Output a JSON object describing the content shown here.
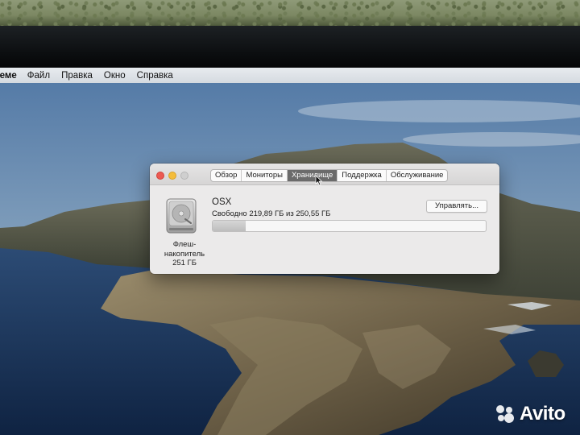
{
  "menubar": {
    "items": [
      "теме",
      "Файл",
      "Правка",
      "Окно",
      "Справка"
    ]
  },
  "window": {
    "tabs": [
      "Обзор",
      "Мониторы",
      "Хранилище",
      "Поддержка",
      "Обслуживание"
    ],
    "active_tab": "Хранилище",
    "disk": {
      "icon": "hard-drive-icon",
      "caption_line1": "Флеш-",
      "caption_line2": "накопитель",
      "caption_line3": "251 ГБ"
    },
    "volume": {
      "name": "OSX",
      "free_text": "Свободно 219,89 ГБ из 250,55 ГБ",
      "used_fraction": 0.122
    },
    "manage_button": "Управлять..."
  },
  "watermark": {
    "text": "Avito"
  },
  "colors": {
    "close": "#ec5a52",
    "minimize": "#f4bd3c",
    "active_tab": "#6b6b6b",
    "storage_used": "#c8c8c8"
  }
}
